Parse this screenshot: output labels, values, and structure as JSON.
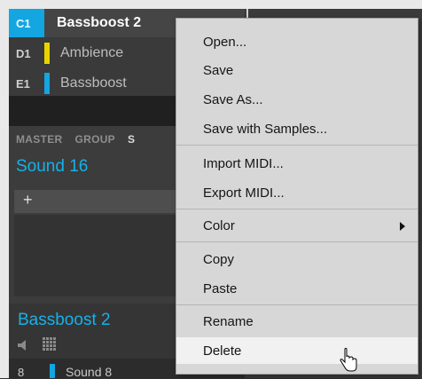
{
  "groups": [
    {
      "index": "C1",
      "name": "Bassboost  2",
      "color": "#13a6e0",
      "selected": true
    },
    {
      "index": "D1",
      "name": "Ambience",
      "color": "#e9d400",
      "selected": false
    },
    {
      "index": "E1",
      "name": "Bassboost",
      "color": "#13a6e0",
      "selected": false
    }
  ],
  "tabs": [
    "MASTER",
    "GROUP",
    "S"
  ],
  "sound_title": "Sound 16",
  "add_symbol": "+",
  "bottom": {
    "title": "Bassboost  2",
    "sound_index": "8",
    "sound_name": "Sound 8"
  },
  "menu": {
    "open": "Open...",
    "save": "Save",
    "save_as": "Save As...",
    "save_with_samples": "Save with Samples...",
    "import_midi": "Import MIDI...",
    "export_midi": "Export MIDI...",
    "color": "Color",
    "copy": "Copy",
    "paste": "Paste",
    "rename": "Rename",
    "delete": "Delete"
  },
  "colors": {
    "accent": "#13a6e0",
    "ambience": "#e9d400",
    "menu_bg": "#d7d7d7",
    "menu_hover": "#f1f1f1"
  },
  "icons": [
    "speaker-icon",
    "grid-icon",
    "submenu-arrow-icon",
    "mouse-cursor-icon"
  ]
}
